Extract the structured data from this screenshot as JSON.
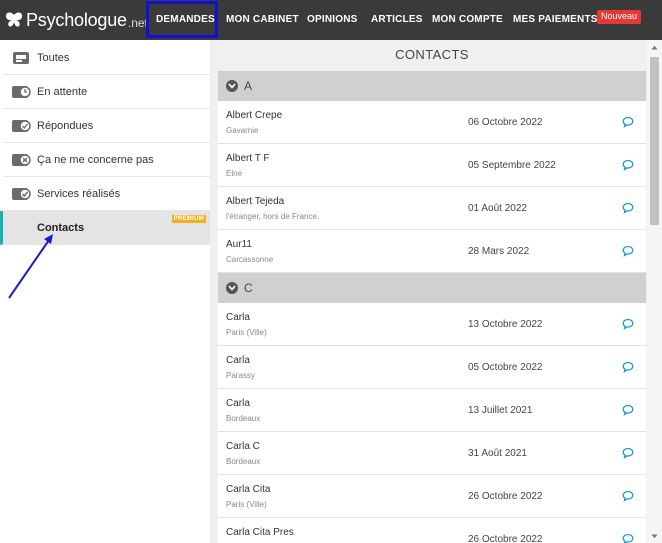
{
  "brand": {
    "name": "Psychologue",
    "suffix": ".net"
  },
  "nav": {
    "items": [
      "DEMANDES",
      "MON CABINET",
      "OPINIONS",
      "ARTICLES",
      "MON COMPTE",
      "MES PAIEMENTS"
    ],
    "active": "DEMANDES",
    "badge": "Nouveau"
  },
  "sidebar": {
    "items": [
      {
        "label": "Toutes",
        "icon": "inbox-icon"
      },
      {
        "label": "En attente",
        "icon": "pending-icon"
      },
      {
        "label": "Répondues",
        "icon": "replied-icon"
      },
      {
        "label": "Ça ne me concerne pas",
        "icon": "rejected-icon"
      },
      {
        "label": "Services réalisés",
        "icon": "done-icon"
      },
      {
        "label": "Contacts",
        "icon": "",
        "active": true,
        "badge": "PREMIUM"
      }
    ]
  },
  "main": {
    "title": "CONTACTS",
    "groups": [
      {
        "letter": "A",
        "rows": [
          {
            "name": "Albert Crepe",
            "location": "Gavarnie",
            "date": "06 Octobre 2022"
          },
          {
            "name": "Albert T F",
            "location": "Elne",
            "date": "05 Septembre 2022"
          },
          {
            "name": "Albert Tejeda",
            "location": "l'étranger, hors de France.",
            "date": "01 Août 2022"
          },
          {
            "name": "Aur11",
            "location": "Carcassonne",
            "date": "28 Mars 2022"
          }
        ]
      },
      {
        "letter": "C",
        "rows": [
          {
            "name": "Carla",
            "location": "Paris (Ville)",
            "date": "13 Octobre 2022"
          },
          {
            "name": "Carla",
            "location": "Parassy",
            "date": "05 Octobre 2022"
          },
          {
            "name": "Carla",
            "location": "Bordeaux",
            "date": "13 Juillet 2021"
          },
          {
            "name": "Carla C",
            "location": "Bordeaux",
            "date": "31 Août 2021"
          },
          {
            "name": "Carla Cita",
            "location": "Paris (Ville)",
            "date": "26 Octobre 2022"
          },
          {
            "name": "Carla Cita Pres",
            "location": "",
            "date": "26 Octobre 2022"
          }
        ]
      }
    ]
  },
  "colors": {
    "nav_bg": "#3a3a3a",
    "highlight_box": "#1010d0",
    "badge_new": "#e53935",
    "premium": "#f2b01e",
    "active_border": "#19b2b2",
    "message_icon": "#1a9ad6",
    "annotation_arrow": "#1a1ad0"
  }
}
